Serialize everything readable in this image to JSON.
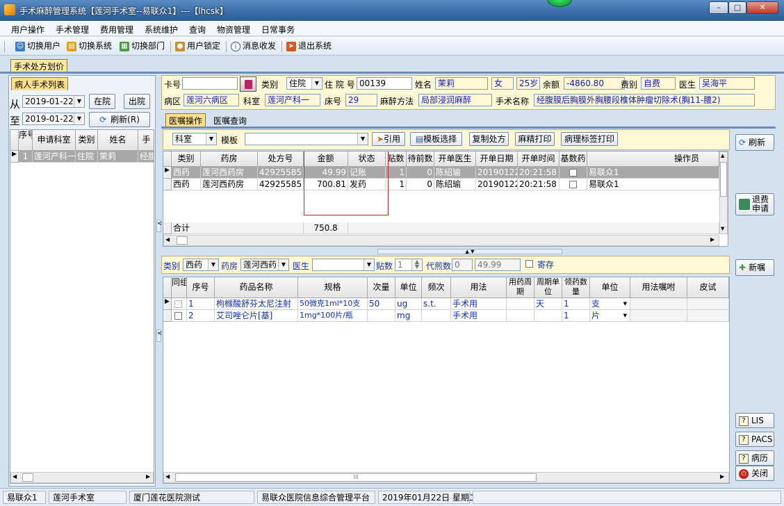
{
  "window": {
    "title": "手术麻醉管理系统【莲河手术室--易联众1】---【lhcsk】",
    "min": "–",
    "max": "□",
    "close": "✕"
  },
  "menu": [
    "用户操作",
    "手术管理",
    "费用管理",
    "系统维护",
    "查询",
    "物资管理",
    "日常事务"
  ],
  "toolbar": {
    "switch_user": "切换用户",
    "switch_system": "切换系统",
    "switch_dept": "切换部门",
    "lock_user": "用户锁定",
    "messages": "消息收发",
    "exit": "退出系统"
  },
  "main_tab": "手术处方划价",
  "left": {
    "tab": "病人手术列表",
    "from_label": "从",
    "to_label": "至",
    "from_date": "2019-01-22",
    "to_date": "2019-01-22",
    "in_hospital": "在院",
    "discharged": "出院",
    "refresh": "刷新(R)",
    "headers": [
      "序号",
      "申请科室",
      "类别",
      "姓名",
      "手"
    ],
    "rows": [
      {
        "no": "1",
        "dept": "莲河产科一",
        "type": "住院",
        "name": "茉莉",
        "extra": "经腹"
      }
    ]
  },
  "patient": {
    "card_label": "卡号",
    "card": "",
    "type_label": "类别",
    "type": "住院",
    "inpatient_label": "住 院 号",
    "inpatient": "00139",
    "name_label": "姓名",
    "name": "茉莉",
    "sex": "女",
    "age": "25岁",
    "balance_label": "余额",
    "balance": "-4860.80",
    "fee_type_label": "费别",
    "fee_type": "自费",
    "doctor_label": "医生",
    "doctor": "吴海平",
    "ward_label": "病区",
    "ward": "莲河六病区",
    "dept_label": "科室",
    "dept": "莲河产科一",
    "bed_label": "床号",
    "bed": "29",
    "anesthesia_label": "麻醉方法",
    "anesthesia": "局部浸润麻醉",
    "surgery_label": "手术名称",
    "surgery": "经腹膜后胸膜外胸腰段椎体肿瘤切除术(胸11-腰2)"
  },
  "order_tabs": [
    "医嘱操作",
    "医嘱查询"
  ],
  "order_toolbar": {
    "dept": "科室",
    "template_label": "模板",
    "template": "",
    "cite": "引用",
    "template_select": "模板选择",
    "copy_rx": "复制处方",
    "narcotic_print": "麻精打印",
    "pathology_print": "病理标签打印"
  },
  "rx_grid": {
    "headers": [
      "类别",
      "药房",
      "处方号",
      "金额",
      "状态",
      "贴数",
      "待前数",
      "开单医生",
      "开单日期",
      "开单时间",
      "基数药",
      "操作员"
    ],
    "rows": [
      {
        "type": "西药",
        "pharmacy": "莲河西药房",
        "rx": "42925585",
        "amount": "49.99",
        "status": "记账",
        "pastes": "1",
        "pending": "0",
        "doctor": "陈绍瑜",
        "date": "20190122",
        "time": "20:21:58",
        "operator": "易联众1"
      },
      {
        "type": "西药",
        "pharmacy": "莲河西药房",
        "rx": "42925585",
        "amount": "700.81",
        "status": "发药",
        "pastes": "1",
        "pending": "0",
        "doctor": "陈绍瑜",
        "date": "20190122",
        "time": "20:21:58",
        "operator": "易联众1"
      }
    ],
    "total_label": "合计",
    "total": "750.8"
  },
  "detail_filter": {
    "type_label": "类别",
    "type": "西药",
    "pharmacy_label": "药房",
    "pharmacy": "莲河西药",
    "doctor_label": "医生",
    "doctor": "",
    "pastes_label": "贴数",
    "pastes": "1",
    "proxy_label": "代煎数",
    "proxy": "0",
    "amount": "49.99",
    "deposit": "寄存"
  },
  "drug_grid": {
    "headers": [
      "同组",
      "序号",
      "药品名称",
      "规格",
      "次量",
      "单位",
      "频次",
      "用法",
      "用药周期",
      "周期单位",
      "领药数量",
      "单位",
      "用法嘱咐",
      "皮试"
    ],
    "rows": [
      {
        "no": "1",
        "name": "枸橼酸舒芬太尼注射",
        "spec": "50微克1ml*10支",
        "dose": "50",
        "unit": "ug",
        "freq": "s.t.",
        "usage": "手术用",
        "cycle": "",
        "cycle_unit": "天",
        "qty": "1",
        "qty_unit": "支"
      },
      {
        "no": "2",
        "name": "艾司唑仑片[基]",
        "spec": "1mg*100片/瓶",
        "dose": "",
        "unit": "mg",
        "freq": "",
        "usage": "手术用",
        "cycle": "",
        "cycle_unit": "",
        "qty": "1",
        "qty_unit": "片"
      }
    ]
  },
  "right_buttons": {
    "refresh": "刷新",
    "refund": "退费申请",
    "new_order": "新嘱",
    "lis": "LIS",
    "pacs": "PACS",
    "history": "病历",
    "close": "关闭"
  },
  "status": {
    "user": "易联众1",
    "room": "莲河手术室",
    "hospital": "厦门莲花医院测试",
    "platform": "易联众医院信息综合管理平台",
    "date": "2019年01月22日 星期二"
  },
  "scroll_mark": "III"
}
